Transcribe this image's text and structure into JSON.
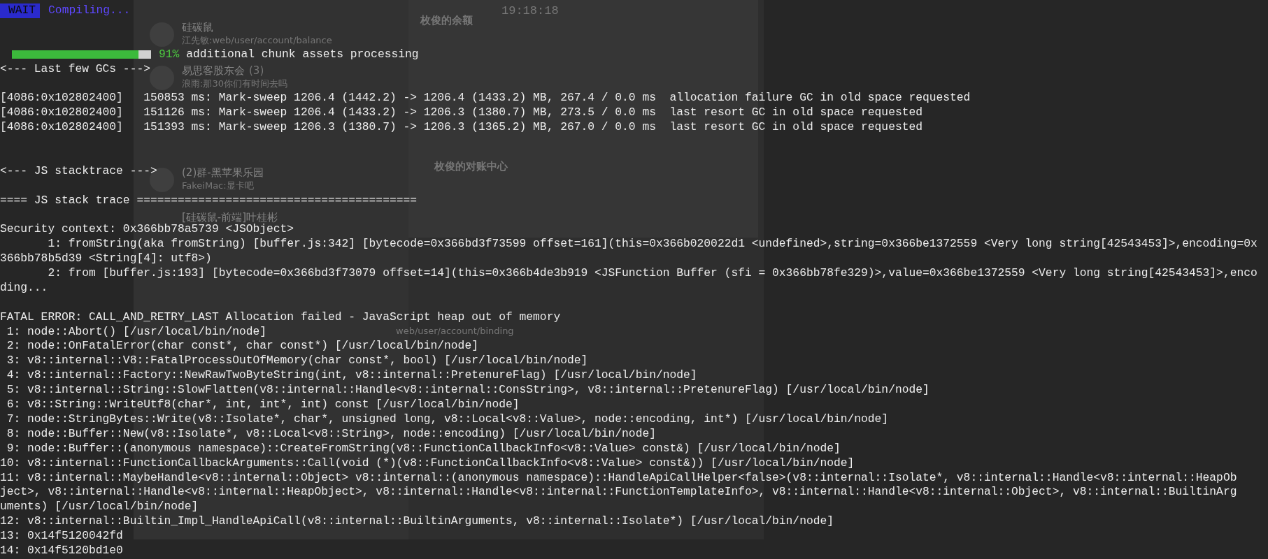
{
  "background_window": {
    "clock": "19:18:18",
    "chats": [
      {
        "name": "硅碳鼠",
        "preview": "江先敏:web/user/account/balance"
      },
      {
        "name": "易思客股东会",
        "count": "(3)",
        "preview": "浪雨:那30你们有时间去吗"
      },
      {
        "name": "(2)群-黑苹果乐园",
        "preview": "FakeiMac:显卡吧"
      },
      {
        "name": "[硅碳鼠-前端]叶桂彬"
      }
    ],
    "panel_headings": [
      "枚俊的余额",
      "枚俊的对账中心"
    ],
    "message": "web/user/account/binding"
  },
  "terminal": {
    "lines": [
      {
        "kind": "status",
        "badge": "WAIT",
        "text": "Compiling..."
      },
      {
        "kind": "blank"
      },
      {
        "kind": "blank"
      },
      {
        "kind": "progress",
        "level": 0.91,
        "percent": "91%",
        "text": "additional chunk assets processing"
      },
      {
        "kind": "text",
        "text": "<--- Last few GCs --->"
      },
      {
        "kind": "blank"
      },
      {
        "kind": "text",
        "text": "[4086:0x102802400]   150853 ms: Mark-sweep 1206.4 (1442.2) -> 1206.4 (1433.2) MB, 267.4 / 0.0 ms  allocation failure GC in old space requested"
      },
      {
        "kind": "text",
        "text": "[4086:0x102802400]   151126 ms: Mark-sweep 1206.4 (1433.2) -> 1206.3 (1380.7) MB, 273.5 / 0.0 ms  last resort GC in old space requested"
      },
      {
        "kind": "text",
        "text": "[4086:0x102802400]   151393 ms: Mark-sweep 1206.3 (1380.7) -> 1206.3 (1365.2) MB, 267.0 / 0.0 ms  last resort GC in old space requested"
      },
      {
        "kind": "blank"
      },
      {
        "kind": "blank"
      },
      {
        "kind": "text",
        "text": "<--- JS stacktrace --->"
      },
      {
        "kind": "blank"
      },
      {
        "kind": "text",
        "text": "==== JS stack trace ========================================="
      },
      {
        "kind": "blank"
      },
      {
        "kind": "text",
        "text": "Security context: 0x366bb78a5739 <JSObject>"
      },
      {
        "kind": "text",
        "text": "       1: fromString(aka fromString) [buffer.js:342] [bytecode=0x366bd3f73599 offset=161](this=0x366b020022d1 <undefined>,string=0x366be1372559 <Very long string[42543453]>,encoding=0x"
      },
      {
        "kind": "text",
        "text": "366bb78b5d39 <String[4]: utf8>)"
      },
      {
        "kind": "text",
        "text": "       2: from [buffer.js:193] [bytecode=0x366bd3f73079 offset=14](this=0x366b4de3b919 <JSFunction Buffer (sfi = 0x366bb78fe329)>,value=0x366be1372559 <Very long string[42543453]>,enco"
      },
      {
        "kind": "text",
        "text": "ding..."
      },
      {
        "kind": "blank"
      },
      {
        "kind": "text",
        "text": "FATAL ERROR: CALL_AND_RETRY_LAST Allocation failed - JavaScript heap out of memory"
      },
      {
        "kind": "text",
        "text": " 1: node::Abort() [/usr/local/bin/node]"
      },
      {
        "kind": "text",
        "text": " 2: node::OnFatalError(char const*, char const*) [/usr/local/bin/node]"
      },
      {
        "kind": "text",
        "text": " 3: v8::internal::V8::FatalProcessOutOfMemory(char const*, bool) [/usr/local/bin/node]"
      },
      {
        "kind": "text",
        "text": " 4: v8::internal::Factory::NewRawTwoByteString(int, v8::internal::PretenureFlag) [/usr/local/bin/node]"
      },
      {
        "kind": "text",
        "text": " 5: v8::internal::String::SlowFlatten(v8::internal::Handle<v8::internal::ConsString>, v8::internal::PretenureFlag) [/usr/local/bin/node]"
      },
      {
        "kind": "text",
        "text": " 6: v8::String::WriteUtf8(char*, int, int*, int) const [/usr/local/bin/node]"
      },
      {
        "kind": "text",
        "text": " 7: node::StringBytes::Write(v8::Isolate*, char*, unsigned long, v8::Local<v8::Value>, node::encoding, int*) [/usr/local/bin/node]"
      },
      {
        "kind": "text",
        "text": " 8: node::Buffer::New(v8::Isolate*, v8::Local<v8::String>, node::encoding) [/usr/local/bin/node]"
      },
      {
        "kind": "text",
        "text": " 9: node::Buffer::(anonymous namespace)::CreateFromString(v8::FunctionCallbackInfo<v8::Value> const&) [/usr/local/bin/node]"
      },
      {
        "kind": "text",
        "text": "10: v8::internal::FunctionCallbackArguments::Call(void (*)(v8::FunctionCallbackInfo<v8::Value> const&)) [/usr/local/bin/node]"
      },
      {
        "kind": "text",
        "text": "11: v8::internal::MaybeHandle<v8::internal::Object> v8::internal::(anonymous namespace)::HandleApiCallHelper<false>(v8::internal::Isolate*, v8::internal::Handle<v8::internal::HeapOb"
      },
      {
        "kind": "text",
        "text": "ject>, v8::internal::Handle<v8::internal::HeapObject>, v8::internal::Handle<v8::internal::FunctionTemplateInfo>, v8::internal::Handle<v8::internal::Object>, v8::internal::BuiltinArg"
      },
      {
        "kind": "text",
        "text": "uments) [/usr/local/bin/node]"
      },
      {
        "kind": "text",
        "text": "12: v8::internal::Builtin_Impl_HandleApiCall(v8::internal::BuiltinArguments, v8::internal::Isolate*) [/usr/local/bin/node]"
      },
      {
        "kind": "text",
        "text": "13: 0x14f5120042fd"
      },
      {
        "kind": "text",
        "text": "14: 0x14f5120bd1e0"
      }
    ]
  }
}
